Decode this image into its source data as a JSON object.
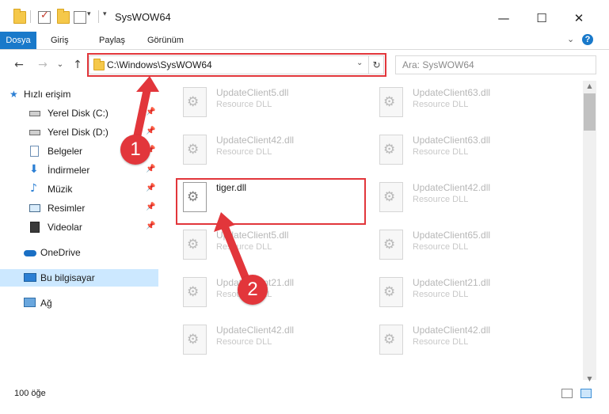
{
  "window": {
    "title": "SysWOW64",
    "minimize_glyph": "—",
    "maximize_glyph": "☐",
    "close_glyph": "✕"
  },
  "ribbon": {
    "tabs": [
      "Dosya",
      "Giriş",
      "Paylaş",
      "Görünüm"
    ],
    "help_glyph": "?",
    "expand_glyph": "⌄"
  },
  "nav": {
    "back_glyph": "←",
    "forward_glyph": "→",
    "recent_glyph": "⌄",
    "up_glyph": "↑",
    "address": "C:\\Windows\\SysWOW64",
    "address_dropdown_glyph": "⌄",
    "refresh_glyph": "↻",
    "search_placeholder": "Ara: SysWOW64"
  },
  "sidebar": {
    "items": [
      {
        "label": "Hızlı erişim",
        "icon": "star-icon",
        "pinned": false
      },
      {
        "label": "Yerel Disk (C:)",
        "icon": "drive-icon",
        "pinned": true
      },
      {
        "label": "Yerel Disk (D:)",
        "icon": "drive-icon",
        "pinned": true
      },
      {
        "label": "Belgeler",
        "icon": "document-icon",
        "pinned": true
      },
      {
        "label": "İndirmeler",
        "icon": "download-icon",
        "pinned": true
      },
      {
        "label": "Müzik",
        "icon": "music-icon",
        "pinned": true
      },
      {
        "label": "Resimler",
        "icon": "pictures-icon",
        "pinned": true
      },
      {
        "label": "Videolar",
        "icon": "video-icon",
        "pinned": true
      },
      {
        "label": "OneDrive",
        "icon": "cloud-icon",
        "pinned": false
      },
      {
        "label": "Bu bilgisayar",
        "icon": "computer-icon",
        "pinned": false,
        "selected": true
      },
      {
        "label": "Ağ",
        "icon": "network-icon",
        "pinned": false
      }
    ],
    "pin_glyph": "📌"
  },
  "files": {
    "left": [
      {
        "name": "UpdateClient5.dll",
        "type": "Resource DLL"
      },
      {
        "name": "UpdateClient42.dll",
        "type": "Resource DLL"
      },
      {
        "name": "tiger.dll",
        "type": "",
        "highlight": true
      },
      {
        "name": "UpdateClient5.dll",
        "type": "Resource DLL"
      },
      {
        "name": "UpdateClient21.dll",
        "type": "Resource DLL"
      },
      {
        "name": "UpdateClient42.dll",
        "type": "Resource DLL"
      }
    ],
    "right": [
      {
        "name": "UpdateClient63.dll",
        "type": "Resource DLL"
      },
      {
        "name": "UpdateClient63.dll",
        "type": "Resource DLL"
      },
      {
        "name": "UpdateClient42.dll",
        "type": "Resource DLL"
      },
      {
        "name": "UpdateClient65.dll",
        "type": "Resource DLL"
      },
      {
        "name": "UpdateClient21.dll",
        "type": "Resource DLL"
      },
      {
        "name": "UpdateClient42.dll",
        "type": "Resource DLL"
      }
    ]
  },
  "scrollbar": {
    "up_glyph": "▲",
    "down_glyph": "▼"
  },
  "status": {
    "item_count": "100 öğe"
  },
  "annotations": {
    "step1": "1",
    "step2": "2"
  },
  "colors": {
    "accent": "#1979ca",
    "highlight": "#e2363b",
    "selected": "#cce8ff"
  }
}
